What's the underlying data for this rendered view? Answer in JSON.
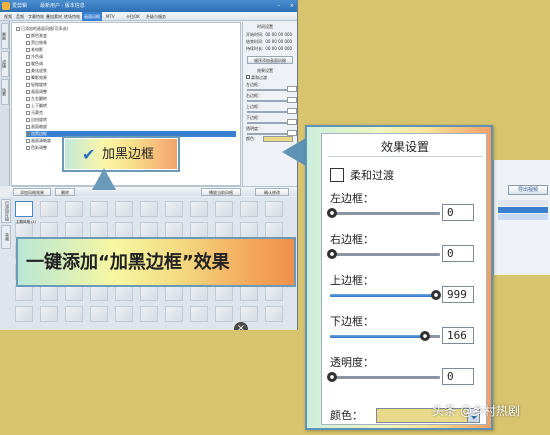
{
  "app": {
    "title": "爱剪辑",
    "title_sub": "最新用户 · 版本信息",
    "menu": [
      "视频",
      "音频",
      "字幕特效",
      "叠加素材",
      "转场特效",
      "画面风格",
      "MTV",
      "卡拉OK",
      "升级与服务"
    ],
    "menu_active_index": 5,
    "side_tabs": [
      "画面",
      "滤镜",
      "动景"
    ],
    "tree": [
      {
        "label": "已添加的画面风格(可多选)",
        "selected": false
      },
      {
        "label": "颜色渐变",
        "selected": false
      },
      {
        "label": "黑白效果",
        "selected": false
      },
      {
        "label": "老电影",
        "selected": false
      },
      {
        "label": "冷色调",
        "selected": false
      },
      {
        "label": "暖色调",
        "selected": false
      },
      {
        "label": "美化皮肤",
        "selected": false
      },
      {
        "label": "晕影效果",
        "selected": false
      },
      {
        "label": "轻微旋转",
        "selected": false
      },
      {
        "label": "画面调整",
        "selected": false
      },
      {
        "label": "左右翻转",
        "selected": false
      },
      {
        "label": "上下翻转",
        "selected": false
      },
      {
        "label": "马赛克",
        "selected": false
      },
      {
        "label": "自由旋转",
        "selected": false
      },
      {
        "label": "画面缩放",
        "selected": false
      },
      {
        "label": "加黑边框",
        "selected": true
      },
      {
        "label": "画面清晰度",
        "selected": false
      },
      {
        "label": "色彩调整",
        "selected": false
      }
    ],
    "right_panel": {
      "heading": "时间设置",
      "rows": [
        "开始时间:",
        "结束时间:",
        "持续时长:"
      ],
      "values": [
        "00 00 00 000",
        "00 00 00 000",
        "00 00 00 000"
      ],
      "button1": "顺序添加画面风格",
      "section": "效果设置"
    },
    "action_buttons": [
      "添加风格效果",
      "删除",
      "播放当前风格",
      "确认修改"
    ],
    "timeline_tabs": [
      "已添加片段",
      "音频"
    ],
    "first_clip_label": "主题风格 (1)"
  },
  "callout_small": {
    "text": "加黑边框",
    "icon": "check-icon"
  },
  "banner": {
    "text": "一键添加“加黑边框”效果"
  },
  "dialog": {
    "title": "效果设置",
    "crossfade_label": "柔和过渡",
    "crossfade_checked": false,
    "sliders": [
      {
        "label": "左边框：",
        "value": "0",
        "fraction": 0.0
      },
      {
        "label": "右边框：",
        "value": "0",
        "fraction": 0.0
      },
      {
        "label": "上边框：",
        "value": "999",
        "fraction": 1.0
      },
      {
        "label": "下边框：",
        "value": "166",
        "fraction": 0.89
      },
      {
        "label": "透明度：",
        "value": "0",
        "fraction": 0.0
      }
    ],
    "color_label": "颜色：",
    "color_value": "#e9da8a"
  },
  "export_button": "导出视频",
  "watermark": "头条 @乡村热剧",
  "colors": {
    "background": "#d8c46e",
    "accent": "#3b7fd0"
  }
}
